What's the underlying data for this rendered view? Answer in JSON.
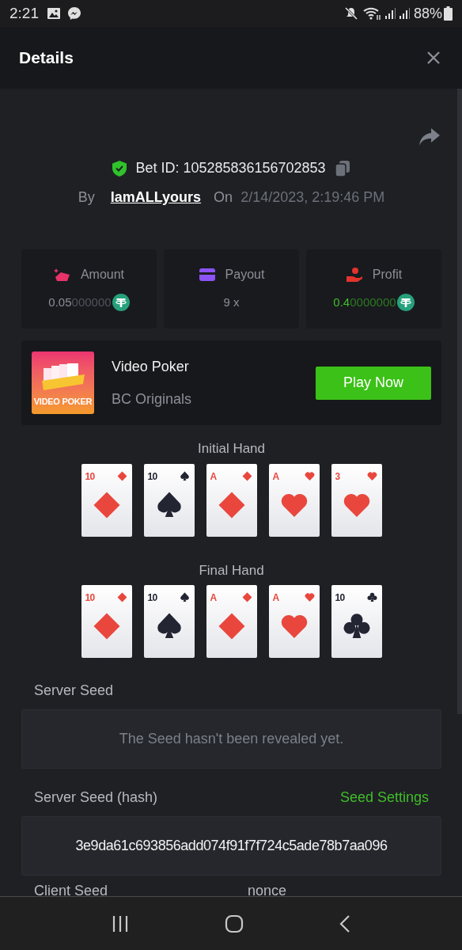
{
  "status_bar": {
    "time": "2:21",
    "battery": "88%"
  },
  "header": {
    "title": "Details"
  },
  "bet": {
    "id_label": "Bet ID: 105285836156702853",
    "by_label": "By",
    "user": "IamALLyours",
    "on_label": "On",
    "date": "2/14/2023, 2:19:46 PM"
  },
  "stats": [
    {
      "kind": "amount",
      "label": "Amount",
      "value_main": "0.05",
      "value_pad": "000000",
      "coin": true
    },
    {
      "kind": "payout",
      "label": "Payout",
      "value_main": "9 x",
      "coin": false
    },
    {
      "kind": "profit",
      "label": "Profit",
      "value_main": "0.4",
      "value_pad": "0000000",
      "coin": true
    }
  ],
  "game": {
    "thumbnail_text": "VIDEO POKER",
    "name": "Video Poker",
    "provider": "BC Originals",
    "button": "Play Now"
  },
  "hands": [
    {
      "title": "Initial Hand",
      "cards": [
        {
          "rank": "10",
          "kind": "diamond"
        },
        {
          "rank": "10",
          "kind": "spade"
        },
        {
          "rank": "A",
          "kind": "diamond"
        },
        {
          "rank": "A",
          "kind": "heart"
        },
        {
          "rank": "3",
          "kind": "heart"
        }
      ]
    },
    {
      "title": "Final Hand",
      "cards": [
        {
          "rank": "10",
          "kind": "diamond"
        },
        {
          "rank": "10",
          "kind": "spade"
        },
        {
          "rank": "A",
          "kind": "diamond"
        },
        {
          "rank": "A",
          "kind": "heart"
        },
        {
          "rank": "10",
          "kind": "club"
        }
      ]
    }
  ],
  "server_seed": {
    "label": "Server Seed",
    "value": "The Seed hasn't been revealed yet."
  },
  "server_seed_hash": {
    "label": "Server Seed (hash)",
    "link": "Seed Settings",
    "value": "3e9da61c693856add074f91f7f724c5ade78b7aa096"
  },
  "bottom_labels": [
    "Client Seed",
    "nonce"
  ]
}
